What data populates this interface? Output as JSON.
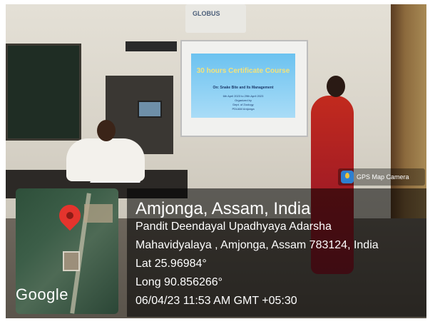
{
  "scene": {
    "ac_brand": "GLOBUS",
    "slide": {
      "title": "30 hours Certificate Course",
      "subtitle": "On: Snake Bite and Its Management",
      "dates": "6th April 2023 to 29th April 2023",
      "organized": "Organized by",
      "dept": "Dept. of Zoology",
      "college": "PDUAM Amjonga"
    }
  },
  "gps": {
    "app_label": "GPS Map Camera",
    "place": "Amjonga, Assam, India",
    "address_line1": "Pandit Deendayal Upadhyaya Adarsha",
    "address_line2": "Mahavidyalaya , Amjonga, Assam 783124, India",
    "lat": "Lat 25.96984°",
    "long": "Long 90.856266°",
    "datetime": "06/04/23 11:53 AM GMT +05:30",
    "map_brand": "Google"
  },
  "colors": {
    "pin": "#e4342d",
    "overlay": "rgba(0,0,0,0.55)",
    "text": "#ffffff"
  },
  "icons": {
    "map_pin": "location-pin-icon",
    "app_logo": "gps-map-camera-icon"
  }
}
